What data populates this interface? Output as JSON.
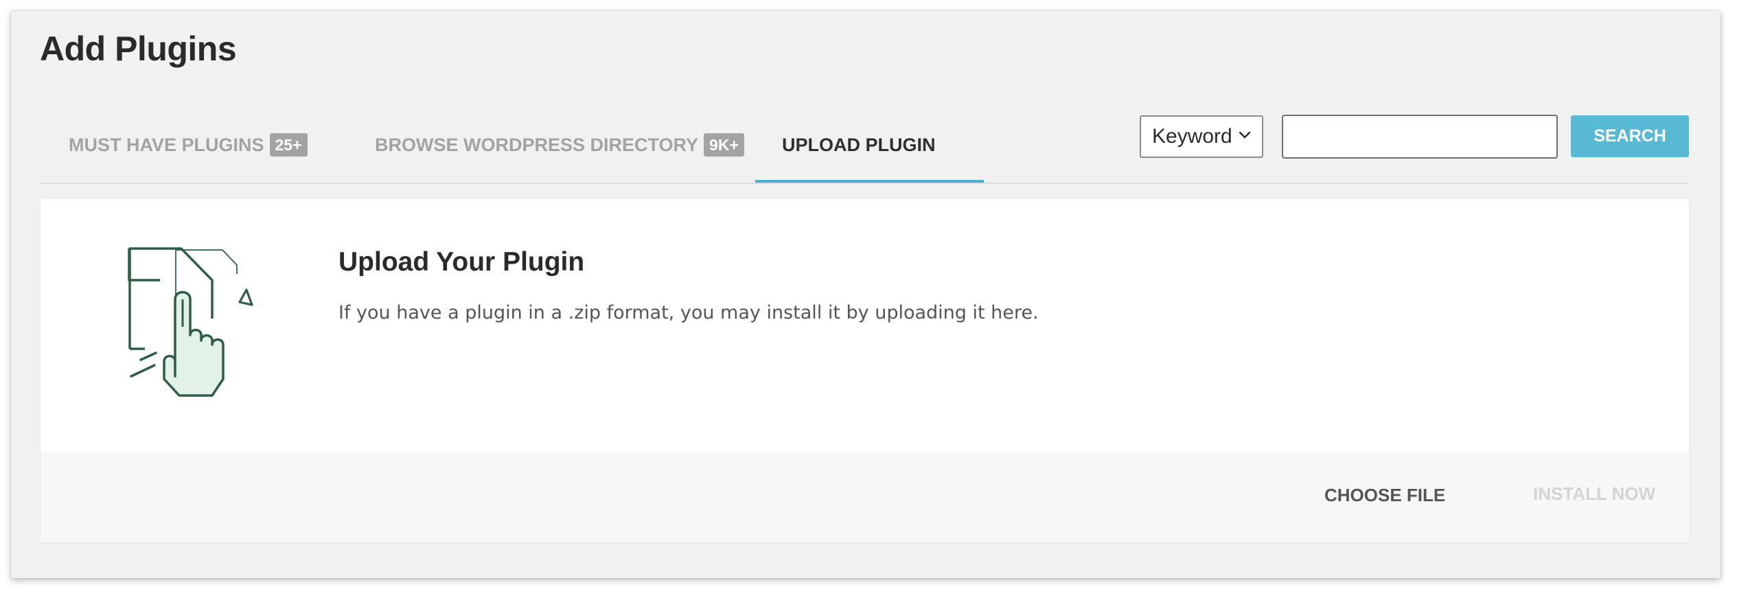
{
  "page": {
    "title": "Add Plugins"
  },
  "tabs": [
    {
      "label": "MUST HAVE PLUGINS",
      "badge": "25+",
      "active": false
    },
    {
      "label": "BROWSE WORDPRESS DIRECTORY",
      "badge": "9K+",
      "active": false
    },
    {
      "label": "UPLOAD PLUGIN",
      "badge": "",
      "active": true
    }
  ],
  "search": {
    "filter_selected": "Keyword",
    "input_value": "",
    "placeholder": "",
    "button_label": "SEARCH"
  },
  "upload": {
    "title": "Upload Your Plugin",
    "description": "If you have a plugin in a .zip format, you may install it by uploading it here.",
    "illustration_icon": "upload-file-hand-icon",
    "choose_file_label": "CHOOSE FILE",
    "install_now_label": "INSTALL NOW",
    "install_enabled": false
  },
  "colors": {
    "accent": "#58b9d4",
    "tab_underline": "#4aaed0",
    "illustration_stroke": "#2d5d45",
    "illustration_fill": "#e3f2e8",
    "muted_text": "#a3a3a3",
    "disabled_text": "#d4d4d4"
  }
}
